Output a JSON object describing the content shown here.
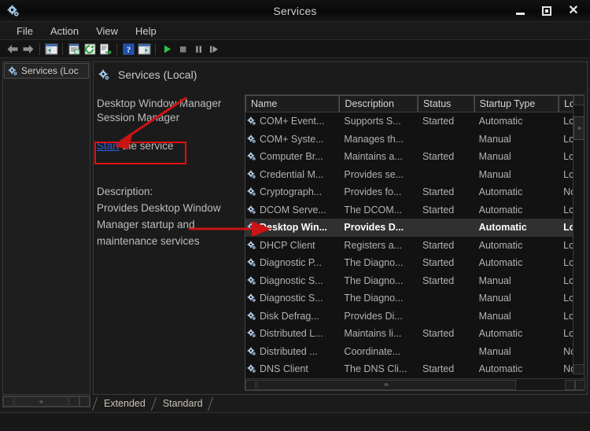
{
  "window": {
    "title": "Services",
    "icon": "services-gear-icon",
    "controls": {
      "minimize": "Minimize",
      "maximize": "Maximize",
      "close": "Close"
    }
  },
  "menubar": {
    "items": [
      "File",
      "Action",
      "View",
      "Help"
    ]
  },
  "toolbar": {
    "items": [
      {
        "name": "back-icon",
        "glyph": "←"
      },
      {
        "name": "forward-icon",
        "glyph": "→"
      },
      {
        "name": "show-hide-console-tree-icon",
        "glyph": "▤"
      },
      {
        "name": "properties-icon",
        "glyph": "▤"
      },
      {
        "name": "refresh-icon",
        "glyph": "↻"
      },
      {
        "name": "export-list-icon",
        "glyph": "▤"
      },
      {
        "name": "help-icon",
        "glyph": "?"
      },
      {
        "name": "show-hide-action-pane-icon",
        "glyph": "▤"
      },
      {
        "name": "start-service-icon",
        "glyph": "▶"
      },
      {
        "name": "stop-service-icon",
        "glyph": "■"
      },
      {
        "name": "pause-service-icon",
        "glyph": "⏸"
      },
      {
        "name": "restart-service-icon",
        "glyph": "⏭"
      }
    ]
  },
  "tree": {
    "root_label": "Services (Loc"
  },
  "details": {
    "pane_title": "Services (Local)",
    "service_name_line1": "Desktop Window Manager",
    "service_name_line2": "Session Manager",
    "action_link": "Start",
    "action_suffix": " the service",
    "description_label": "Description:",
    "description_line1": "Provides Desktop Window",
    "description_line2": "Manager startup and",
    "description_line3": "maintenance services"
  },
  "list": {
    "columns": [
      {
        "label": "Name",
        "width": 120
      },
      {
        "label": "Description",
        "width": 100
      },
      {
        "label": "Status",
        "width": 72
      },
      {
        "label": "Startup Type",
        "width": 108
      },
      {
        "label": "Lc",
        "width": 32
      }
    ],
    "rows": [
      {
        "name": "COM+ Event...",
        "description": "Supports S...",
        "status": "Started",
        "startup": "Automatic",
        "logon": "Lc",
        "selected": false
      },
      {
        "name": "COM+ Syste...",
        "description": "Manages th...",
        "status": "",
        "startup": "Manual",
        "logon": "Lc",
        "selected": false
      },
      {
        "name": "Computer Br...",
        "description": "Maintains a...",
        "status": "Started",
        "startup": "Manual",
        "logon": "Lc",
        "selected": false
      },
      {
        "name": "Credential M...",
        "description": "Provides se...",
        "status": "",
        "startup": "Manual",
        "logon": "Lc",
        "selected": false
      },
      {
        "name": "Cryptograph...",
        "description": "Provides fo...",
        "status": "Started",
        "startup": "Automatic",
        "logon": "Nc",
        "selected": false
      },
      {
        "name": "DCOM Serve...",
        "description": "The DCOM...",
        "status": "Started",
        "startup": "Automatic",
        "logon": "Lc",
        "selected": false
      },
      {
        "name": "Desktop Win...",
        "description": "Provides D...",
        "status": "",
        "startup": "Automatic",
        "logon": "Lc",
        "selected": true
      },
      {
        "name": "DHCP Client",
        "description": "Registers a...",
        "status": "Started",
        "startup": "Automatic",
        "logon": "Lc",
        "selected": false
      },
      {
        "name": "Diagnostic P...",
        "description": "The Diagno...",
        "status": "Started",
        "startup": "Automatic",
        "logon": "Lc",
        "selected": false
      },
      {
        "name": "Diagnostic S...",
        "description": "The Diagno...",
        "status": "Started",
        "startup": "Manual",
        "logon": "Lc",
        "selected": false
      },
      {
        "name": "Diagnostic S...",
        "description": "The Diagno...",
        "status": "",
        "startup": "Manual",
        "logon": "Lc",
        "selected": false
      },
      {
        "name": "Disk Defrag...",
        "description": "Provides Di...",
        "status": "",
        "startup": "Manual",
        "logon": "Lc",
        "selected": false
      },
      {
        "name": "Distributed L...",
        "description": "Maintains li...",
        "status": "Started",
        "startup": "Automatic",
        "logon": "Lc",
        "selected": false
      },
      {
        "name": "Distributed ...",
        "description": "Coordinate...",
        "status": "",
        "startup": "Manual",
        "logon": "Nc",
        "selected": false
      },
      {
        "name": "DNS Client",
        "description": "The DNS Cli...",
        "status": "Started",
        "startup": "Automatic",
        "logon": "Nc",
        "selected": false
      }
    ]
  },
  "tabs": {
    "items": [
      "Extended",
      "Standard"
    ],
    "active": "Extended"
  },
  "annotations": {
    "highlight_color": "#e01010",
    "arrow1_target": "Start the service link",
    "arrow2_target": "Desktop Window Manager Session Manager row"
  },
  "colors": {
    "accent_link": "#2b5fe8",
    "annotation_red": "#e01010",
    "window_bg": "#1b1b1b",
    "list_bg": "#121212",
    "selection_bg": "#303030"
  }
}
